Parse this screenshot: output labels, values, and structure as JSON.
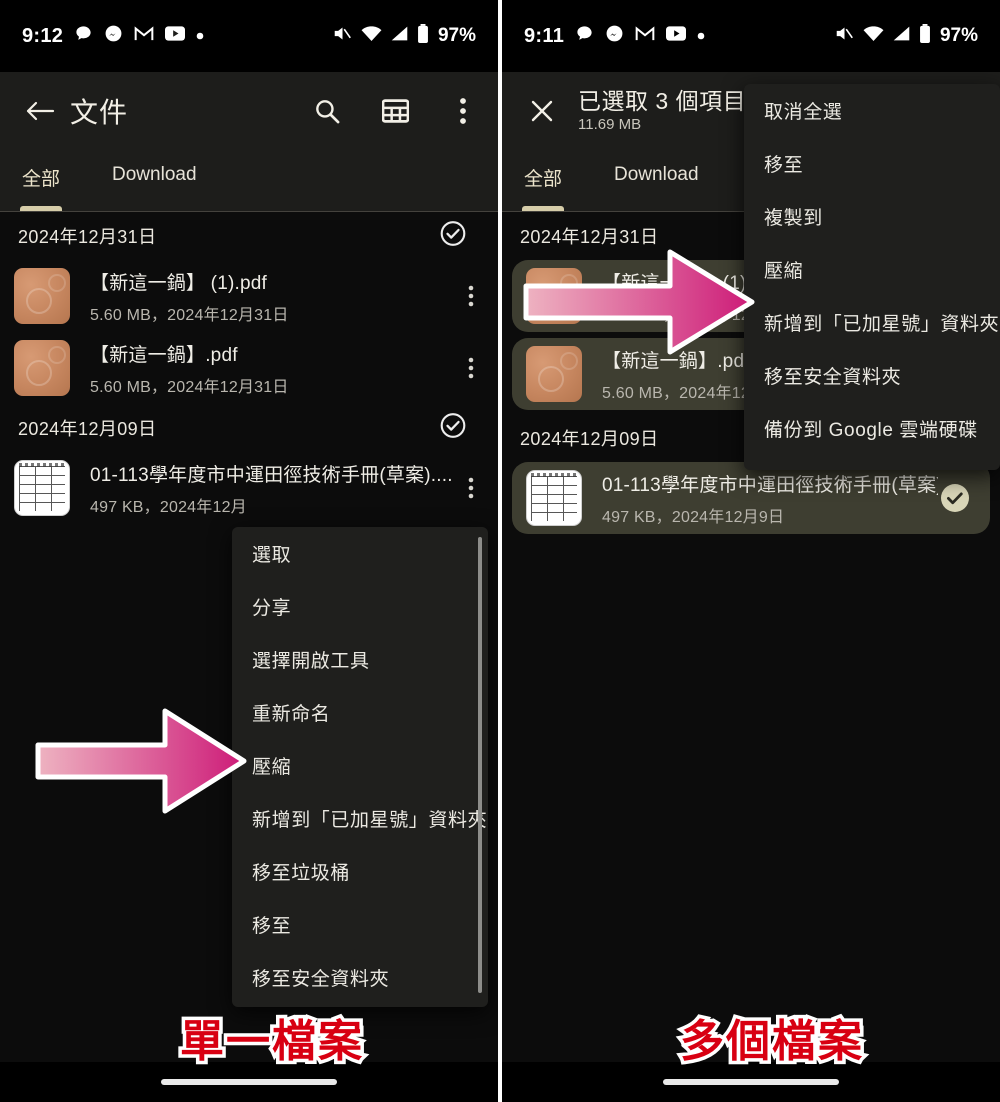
{
  "left_panel": {
    "status_bar": {
      "time": "9:12",
      "battery": "97%",
      "icons": [
        "chat-bubble-icon",
        "messenger-icon",
        "gmail-icon",
        "youtube-icon",
        "dot-icon"
      ],
      "right_icons": [
        "mute-icon",
        "wifi-icon",
        "signal-icon",
        "battery-icon"
      ]
    },
    "app_bar": {
      "back_icon": "back-arrow-icon",
      "title": "文件",
      "actions": [
        "search-icon",
        "grid-view-icon",
        "overflow-menu-icon"
      ]
    },
    "tabs": [
      {
        "label": "全部",
        "active": true
      },
      {
        "label": "Download",
        "active": false
      }
    ],
    "groups": [
      {
        "date": "2024年12月31日",
        "files": [
          {
            "name": "【新這一鍋】 (1).pdf",
            "sub": "5.60 MB，2024年12月31日",
            "thumb": "pdf"
          },
          {
            "name": "【新這一鍋】.pdf",
            "sub": "5.60 MB，2024年12月31日",
            "thumb": "pdf"
          }
        ]
      },
      {
        "date": "2024年12月09日",
        "files": [
          {
            "name": "01-113學年度市中運田徑技術手冊(草案)....",
            "sub": "497 KB，2024年12月",
            "thumb": "sheet"
          }
        ]
      }
    ],
    "context_menu": [
      "選取",
      "分享",
      "選擇開啟工具",
      "重新命名",
      "壓縮",
      "新增到「已加星號」資料夾",
      "移至垃圾桶",
      "移至",
      "移至安全資料夾"
    ],
    "highlighted_menu_item": "壓縮",
    "caption": "單一檔案"
  },
  "right_panel": {
    "status_bar": {
      "time": "9:11",
      "battery": "97%",
      "icons": [
        "chat-bubble-icon",
        "messenger-icon",
        "gmail-icon",
        "youtube-icon",
        "dot-icon"
      ],
      "right_icons": [
        "mute-icon",
        "wifi-icon",
        "signal-icon",
        "battery-icon"
      ]
    },
    "selection_bar": {
      "close_icon": "close-icon",
      "title": "已選取 3 個項目",
      "subtitle": "11.69 MB"
    },
    "tabs": [
      {
        "label": "全部",
        "active": true
      },
      {
        "label": "Download",
        "active": false
      }
    ],
    "groups": [
      {
        "date": "2024年12月31日",
        "files": [
          {
            "name": "【新這一鍋】 (1).pdf",
            "sub": "5.60 MB，2024年12月",
            "thumb": "pdf",
            "selected": true
          },
          {
            "name": "【新這一鍋】.pdf",
            "sub": "5.60 MB，2024年12月",
            "thumb": "pdf",
            "selected": true
          }
        ]
      },
      {
        "date": "2024年12月09日",
        "files": [
          {
            "name": "01-113學年度市中運田徑技術手冊(草案)....",
            "sub": "497 KB，2024年12月9日",
            "thumb": "sheet",
            "selected": true
          }
        ]
      }
    ],
    "context_menu": [
      "取消全選",
      "移至",
      "複製到",
      "壓縮",
      "新增到「已加星號」資料夾",
      "移至安全資料夾",
      "備份到 Google 雲端硬碟"
    ],
    "highlighted_menu_item": "壓縮",
    "caption": "多個檔案"
  },
  "colors": {
    "arrow_start": "#eeb3c1",
    "arrow_end": "#cd1b78",
    "arrow_outline": "#ffffff",
    "caption_fill": "#d80012",
    "caption_stroke": "#ffffff",
    "selected_row_bg": "#3e3e31",
    "check_fill": "#d9d6b8",
    "tab_active": "#ece4cb",
    "app_bar_bg": "#1d1d1b",
    "menu_bg": "#1f1f1d",
    "page_bg": "#0c0c0c"
  },
  "annotations": {
    "arrows": [
      {
        "name": "arrow-left",
        "points_to": "壓縮"
      },
      {
        "name": "arrow-right",
        "points_to": "壓縮"
      }
    ]
  }
}
